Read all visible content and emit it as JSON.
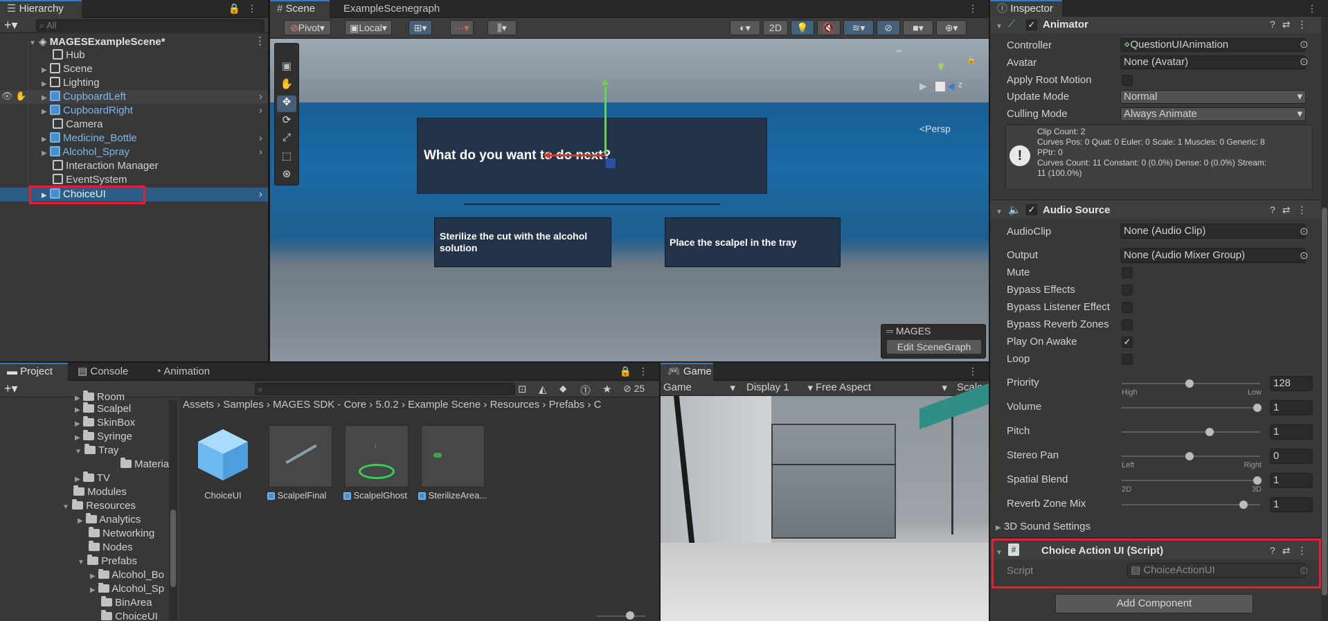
{
  "hierarchy": {
    "tab": "Hierarchy",
    "search_placeholder": "All",
    "scene_name": "MAGESExampleScene*",
    "items": [
      {
        "label": "Hub"
      },
      {
        "label": "Scene"
      },
      {
        "label": "Lighting"
      },
      {
        "label": "CupboardLeft"
      },
      {
        "label": "CupboardRight"
      },
      {
        "label": "Camera"
      },
      {
        "label": "Medicine_Bottle"
      },
      {
        "label": "Alcohol_Spray"
      },
      {
        "label": "Interaction Manager"
      },
      {
        "label": "EventSystem"
      },
      {
        "label": "ChoiceUI"
      }
    ]
  },
  "scene": {
    "tabs": [
      "Scene",
      "ExampleScenegraph"
    ],
    "pivot": "Pivot",
    "local": "Local",
    "mode_2d": "2D",
    "question": "What do you want to do next?",
    "choice_left": "Sterilize the cut with the alcohol solution",
    "choice_right": "Place the scalpel in the tray",
    "persp": "<Persp",
    "mages_label": "MAGES",
    "edit_scenegraph": "Edit SceneGraph"
  },
  "project": {
    "tabs": [
      "Project",
      "Console",
      "Animation"
    ],
    "hidden_count": "25",
    "tree": [
      {
        "label": "Room"
      },
      {
        "label": "Scalpel"
      },
      {
        "label": "SkinBox"
      },
      {
        "label": "Syringe"
      },
      {
        "label": "Tray"
      },
      {
        "label": "Materials"
      },
      {
        "label": "TV"
      },
      {
        "label": "Modules"
      },
      {
        "label": "Resources"
      },
      {
        "label": "Analytics"
      },
      {
        "label": "Networking"
      },
      {
        "label": "Nodes"
      },
      {
        "label": "Prefabs"
      },
      {
        "label": "Alcohol_Bo"
      },
      {
        "label": "Alcohol_Sp"
      },
      {
        "label": "BinArea"
      },
      {
        "label": "ChoiceUI"
      }
    ],
    "breadcrumb": [
      "Assets",
      "Samples",
      "MAGES SDK - Core",
      "5.0.2",
      "Example Scene",
      "Resources",
      "Prefabs",
      "C"
    ],
    "assets": [
      {
        "label": "ChoiceUI"
      },
      {
        "label": "ScalpelFinal"
      },
      {
        "label": "ScalpelGhost"
      },
      {
        "label": "SterilizeArea..."
      }
    ]
  },
  "game": {
    "tab": "Game",
    "mode": "Game",
    "display": "Display 1",
    "aspect": "Free Aspect",
    "scale": "Scale"
  },
  "inspector": {
    "tab": "Inspector",
    "animator": {
      "title": "Animator",
      "rows": [
        {
          "label": "Controller",
          "value": "QuestionUIAnimation"
        },
        {
          "label": "Avatar",
          "value": "None (Avatar)"
        },
        {
          "label": "Apply Root Motion",
          "value": ""
        },
        {
          "label": "Update Mode",
          "value": "Normal"
        },
        {
          "label": "Culling Mode",
          "value": "Always Animate"
        }
      ],
      "info": [
        "Clip Count: 2",
        "Curves Pos: 0 Quat: 0 Euler: 0 Scale: 1 Muscles: 0 Generic: 8",
        "PPtr: 0",
        "Curves Count: 11 Constant: 0 (0.0%) Dense: 0 (0.0%) Stream:",
        "11 (100.0%)"
      ]
    },
    "audio": {
      "title": "Audio Source",
      "clip_label": "AudioClip",
      "clip_value": "None (Audio Clip)",
      "output_label": "Output",
      "output_value": "None (Audio Mixer Group)",
      "toggles": [
        {
          "label": "Mute",
          "checked": false
        },
        {
          "label": "Bypass Effects",
          "checked": false
        },
        {
          "label": "Bypass Listener Effect",
          "checked": false
        },
        {
          "label": "Bypass Reverb Zones",
          "checked": false
        },
        {
          "label": "Play On Awake",
          "checked": true
        },
        {
          "label": "Loop",
          "checked": false
        }
      ],
      "sliders": [
        {
          "label": "Priority",
          "value": "128",
          "fraction": 0.5,
          "low": "High",
          "high": "Low"
        },
        {
          "label": "Volume",
          "value": "1",
          "fraction": 1.0,
          "low": "",
          "high": ""
        },
        {
          "label": "Pitch",
          "value": "1",
          "fraction": 0.65,
          "low": "",
          "high": ""
        },
        {
          "label": "Stereo Pan",
          "value": "0",
          "fraction": 0.5,
          "low": "Left",
          "high": "Right"
        },
        {
          "label": "Spatial Blend",
          "value": "1",
          "fraction": 1.0,
          "low": "2D",
          "high": "3D"
        },
        {
          "label": "Reverb Zone Mix",
          "value": "1",
          "fraction": 0.9,
          "low": "",
          "high": ""
        }
      ],
      "sound_settings": "3D Sound Settings"
    },
    "script_component": {
      "title": "Choice Action UI (Script)",
      "label": "Script",
      "value": "ChoiceActionUI"
    },
    "add_component": "Add Component"
  }
}
